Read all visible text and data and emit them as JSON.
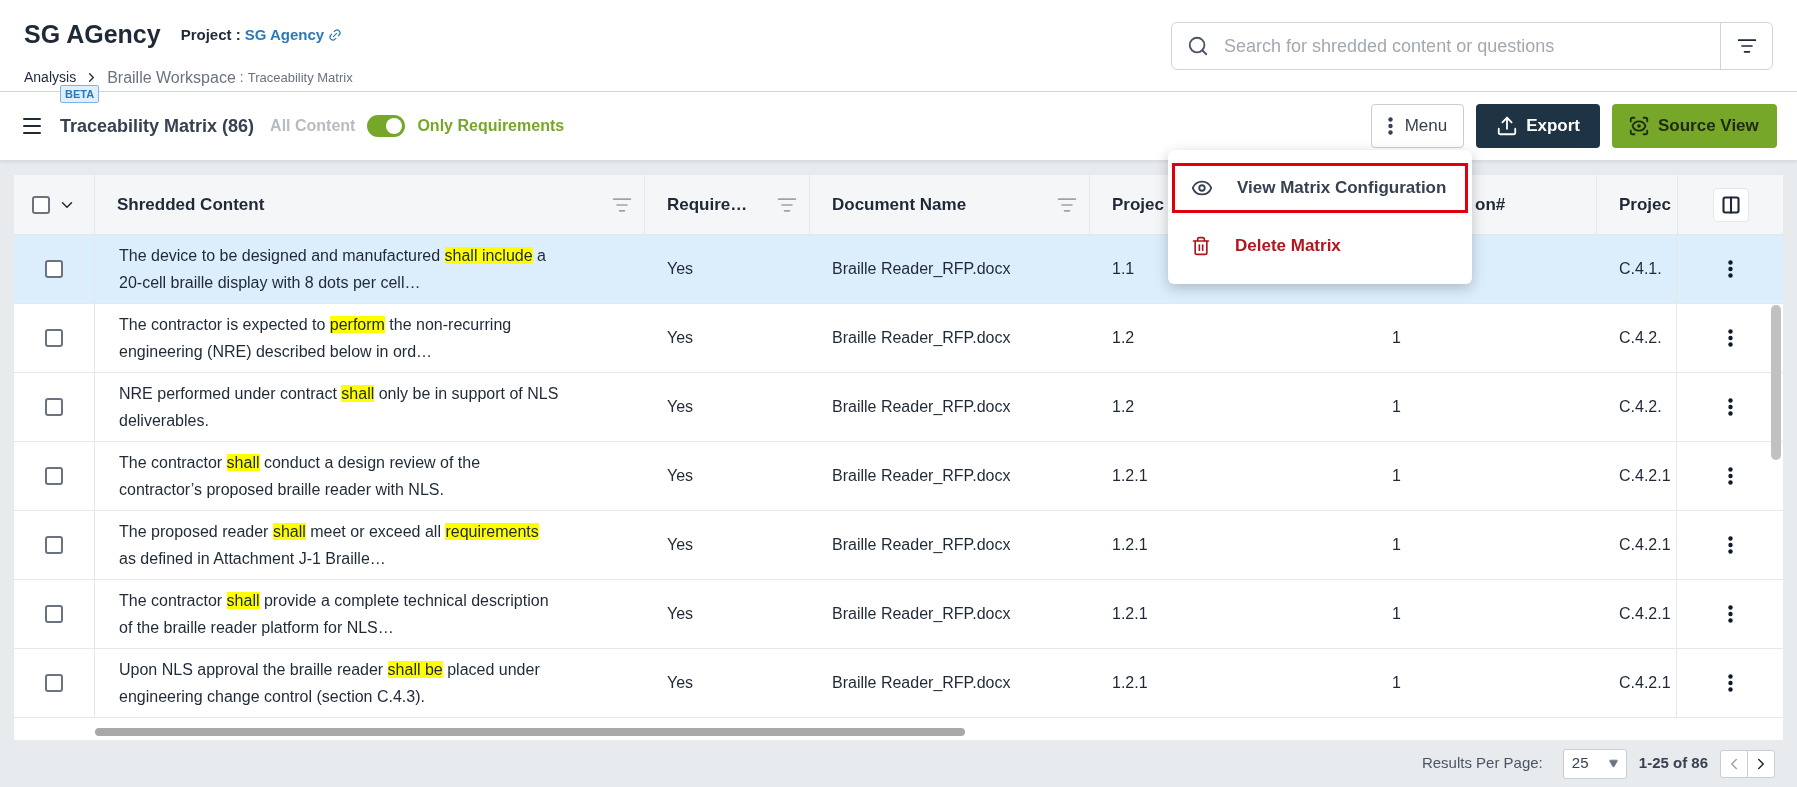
{
  "header": {
    "title": "SG AGency",
    "project_label": "Project :",
    "project_link": "SG Agency",
    "breadcrumb": {
      "root": "Analysis",
      "workspace": "Braille Workspace",
      "separator": ":",
      "page": "Traceability Matrix"
    }
  },
  "search": {
    "placeholder": "Search for shredded content or questions"
  },
  "toolbar": {
    "badge": "BETA",
    "title": "Traceability Matrix (86)",
    "toggle": {
      "off_label": "All Content",
      "on_label": "Only Requirements",
      "on": true
    },
    "buttons": [
      {
        "kind": "menu",
        "label": "Menu"
      },
      {
        "kind": "export",
        "label": "Export"
      },
      {
        "kind": "source",
        "label": "Source View"
      }
    ]
  },
  "menu": {
    "items": [
      {
        "kind": "view",
        "label": "View Matrix Configuration",
        "highlighted": true
      },
      {
        "kind": "delete",
        "label": "Delete Matrix",
        "highlighted": false
      }
    ]
  },
  "table": {
    "all_checked": false,
    "columns": [
      {
        "label": "Shredded Content",
        "filter": true
      },
      {
        "label": "Require…",
        "filter": true
      },
      {
        "label": "Document Name",
        "filter": true
      },
      {
        "label": "Projec",
        "filter": false
      },
      {
        "label": "on#",
        "filter": false
      },
      {
        "label": "Projec",
        "filter": false
      }
    ],
    "rows": [
      {
        "selected": true,
        "checked": false,
        "content": [
          {
            "text": "The device to be designed and manufactured ",
            "highlighted": false
          },
          {
            "text": "shall include",
            "highlighted": true
          },
          {
            "text": " a 20-cell braille display with 8 dots per cell…",
            "highlighted": false
          }
        ],
        "requirement": "Yes",
        "document": "Braille Reader_RFP.docx",
        "project": "1.1",
        "section": null,
        "project_2": "C.4.1."
      },
      {
        "selected": false,
        "checked": false,
        "content": [
          {
            "text": "The contractor is expected to ",
            "highlighted": false
          },
          {
            "text": "perform",
            "highlighted": true
          },
          {
            "text": " the non-recurring engineering (NRE) described below in ord…",
            "highlighted": false
          }
        ],
        "requirement": "Yes",
        "document": "Braille Reader_RFP.docx",
        "project": "1.2",
        "section": "1",
        "project_2": "C.4.2."
      },
      {
        "selected": false,
        "checked": false,
        "content": [
          {
            "text": "NRE performed under contract ",
            "highlighted": false
          },
          {
            "text": "shall",
            "highlighted": true
          },
          {
            "text": " only be in support of NLS deliverables.",
            "highlighted": false
          }
        ],
        "requirement": "Yes",
        "document": "Braille Reader_RFP.docx",
        "project": "1.2",
        "section": "1",
        "project_2": "C.4.2."
      },
      {
        "selected": false,
        "checked": false,
        "content": [
          {
            "text": "The contractor ",
            "highlighted": false
          },
          {
            "text": "shall",
            "highlighted": true
          },
          {
            "text": " conduct a design review of the contractor’s proposed braille reader with NLS.",
            "highlighted": false
          }
        ],
        "requirement": "Yes",
        "document": "Braille Reader_RFP.docx",
        "project": "1.2.1",
        "section": "1",
        "project_2": "C.4.2.1"
      },
      {
        "selected": false,
        "checked": false,
        "content": [
          {
            "text": "The proposed reader ",
            "highlighted": false
          },
          {
            "text": "shall",
            "highlighted": true
          },
          {
            "text": " meet or exceed all ",
            "highlighted": false
          },
          {
            "text": "requirements",
            "highlighted": true
          },
          {
            "text": " as defined in Attachment J-1 Braille…",
            "highlighted": false
          }
        ],
        "requirement": "Yes",
        "document": "Braille Reader_RFP.docx",
        "project": "1.2.1",
        "section": "1",
        "project_2": "C.4.2.1"
      },
      {
        "selected": false,
        "checked": false,
        "content": [
          {
            "text": "The contractor ",
            "highlighted": false
          },
          {
            "text": "shall",
            "highlighted": true
          },
          {
            "text": " provide a complete technical description of the braille reader platform for NLS…",
            "highlighted": false
          }
        ],
        "requirement": "Yes",
        "document": "Braille Reader_RFP.docx",
        "project": "1.2.1",
        "section": "1",
        "project_2": "C.4.2.1"
      },
      {
        "selected": false,
        "checked": false,
        "content": [
          {
            "text": "Upon NLS approval the braille reader ",
            "highlighted": false
          },
          {
            "text": "shall be",
            "highlighted": true
          },
          {
            "text": " placed under engineering change control (section C.4.3).",
            "highlighted": false
          }
        ],
        "requirement": "Yes",
        "document": "Braille Reader_RFP.docx",
        "project": "1.2.1",
        "section": "1",
        "project_2": "C.4.2.1"
      }
    ]
  },
  "pagination": {
    "label": "Results Per Page:",
    "page_size": "25",
    "range": "1-25 of 86"
  }
}
